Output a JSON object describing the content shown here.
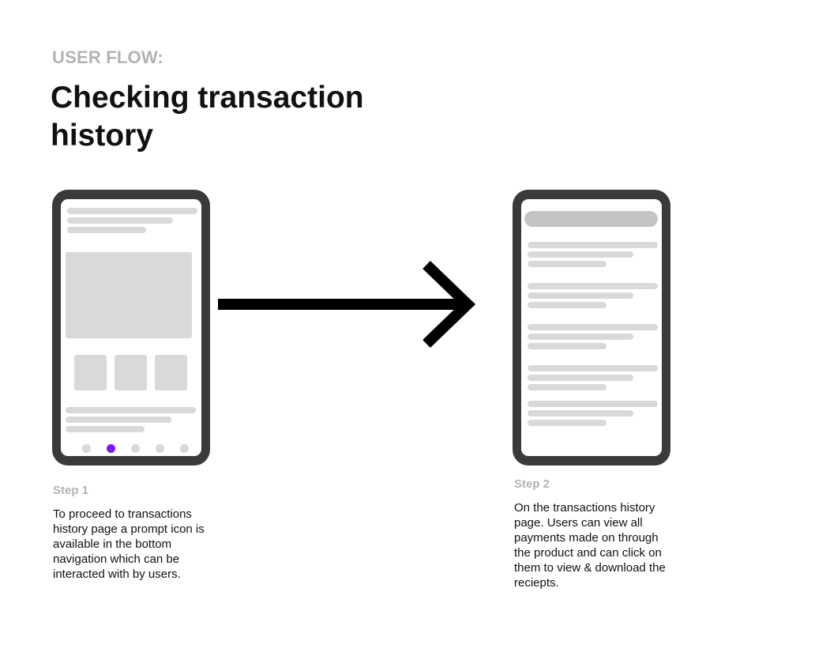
{
  "header": {
    "eyebrow": "USER FLOW:",
    "title": "Checking transaction history"
  },
  "steps": [
    {
      "label": "Step 1",
      "description": "To proceed to transactions history page a prompt icon is available in the bottom navigation which can be interacted with by users."
    },
    {
      "label": "Step 2",
      "description": "On the transactions history page. Users can view all payments made on through the product and can click on them to view & download the reciepts."
    }
  ],
  "colors": {
    "phone_frame": "#3a3a3a",
    "placeholder": "#d9d9d9",
    "search_bar": "#c4c4c4",
    "active_nav_dot": "#7a19f0",
    "muted_text": "#b3b3b3"
  },
  "icons": {
    "flow_arrow": "right-arrow-icon"
  }
}
